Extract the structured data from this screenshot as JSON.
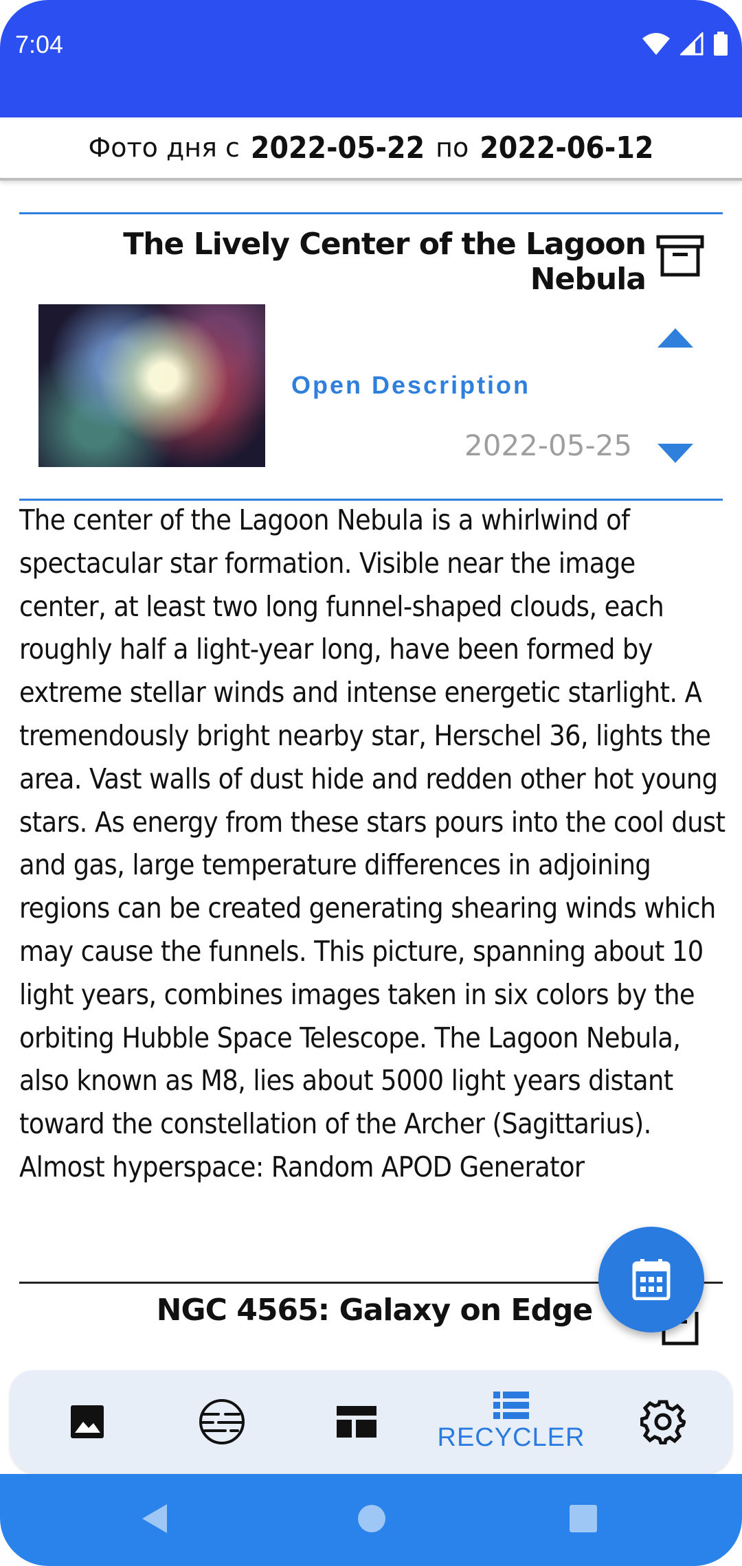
{
  "status_bar": {
    "time": "7:04"
  },
  "period": {
    "prefix": "Фото дня с",
    "start": "2022-05-22",
    "middle": "по",
    "end": "2022-06-12"
  },
  "card": {
    "title": "The Lively Center of the Lagoon Nebula",
    "open_description_label": "Open Description",
    "date": "2022-05-25",
    "description": "The center of the Lagoon Nebula is a whirlwind of spectacular star formation. Visible near the image center, at least two long funnel-shaped clouds, each roughly half a light-year long, have been formed by extreme stellar winds and intense energetic starlight.  A tremendously bright nearby star, Herschel 36, lights the area.  Vast walls of dust hide and redden other hot young stars.  As energy from these stars pours into the cool dust and gas, large temperature differences in adjoining regions can be created generating shearing winds which may cause the funnels.  This picture, spanning about 10 light years, combines images taken in six colors by the orbiting Hubble Space Telescope.  The Lagoon Nebula, also known as M8, lies about 5000 light years distant toward the constellation of the Archer (Sagittarius).   Almost hyperspace: Random APOD Generator"
  },
  "next_card": {
    "title": "NGC 4565: Galaxy on Edge"
  },
  "bottom_nav": {
    "items": [
      {
        "icon": "image-icon",
        "label": ""
      },
      {
        "icon": "planet-icon",
        "label": ""
      },
      {
        "icon": "layout-icon",
        "label": ""
      },
      {
        "icon": "list-icon",
        "label": "RECYCLER",
        "active": true
      },
      {
        "icon": "gear-icon",
        "label": ""
      }
    ]
  },
  "colors": {
    "status_bar": "#2b4ff0",
    "accent": "#2f7fdc",
    "fab": "#2a7be0",
    "nav_bg": "#e8eef8",
    "system_nav": "#2a83ea"
  }
}
